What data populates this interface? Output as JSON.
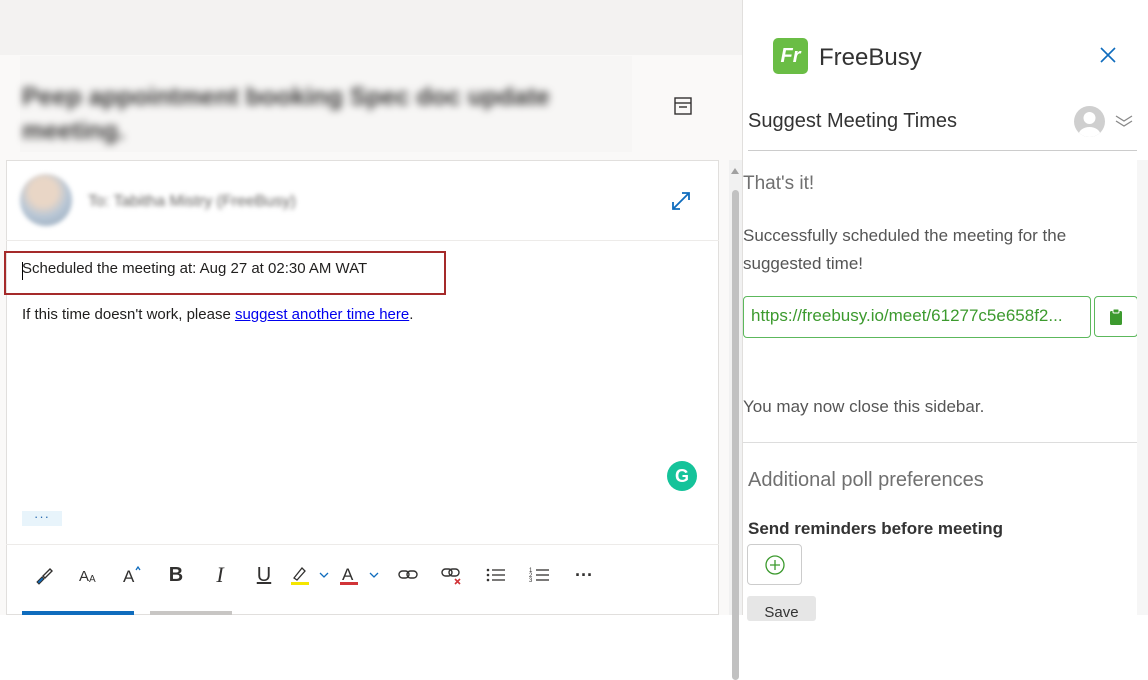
{
  "email": {
    "subject": "Peep appointment booking Spec doc update meeting.",
    "to_line": "To: Tabitha Mistry (FreeBusy)",
    "body_line1": "Scheduled the meeting at: Aug 27 at 02:30 AM WAT",
    "body_line2_prefix": "If this time doesn't work, please ",
    "body_line2_link": "suggest another time here",
    "body_line2_suffix": ".",
    "more_label": "···",
    "grammarly_label": "G"
  },
  "toolbar": {
    "items": [
      "format-painter-icon",
      "font-size-icon",
      "font-grow-icon",
      "bold-icon",
      "italic-icon",
      "underline-icon",
      "highlight-icon",
      "font-color-icon",
      "link-icon",
      "unlink-icon",
      "bullets-icon",
      "numbering-icon",
      "more-icon"
    ],
    "bold_glyph": "B",
    "italic_glyph": "I",
    "underline_glyph": "U",
    "more_glyph": "···"
  },
  "sidebar": {
    "logo_text": "Fr",
    "brand": "FreeBusy",
    "section_title": "Suggest Meeting Times",
    "done_title": "That's it!",
    "success_msg": "Successfully scheduled the meeting for the suggested time!",
    "meeting_link": "https://freebusy.io/meet/61277c5e658f2...",
    "close_msg": "You may now close this sidebar.",
    "additional_title": "Additional poll preferences",
    "reminders_label": "Send reminders before meeting",
    "save_label": "Save"
  },
  "colors": {
    "brand_green": "#6abd45",
    "link_green": "#3c9a2e",
    "highlight_border": "#a52a2a",
    "accent_blue": "#0f6cbd"
  }
}
